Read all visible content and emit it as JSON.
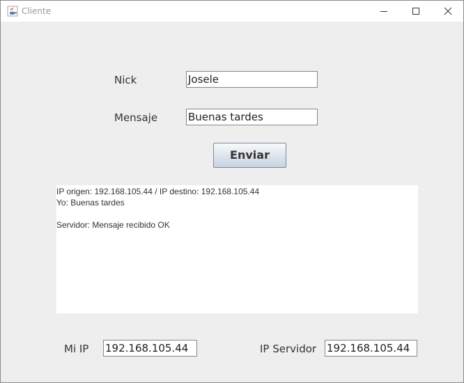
{
  "window": {
    "title": "Cliente",
    "app_icon": "java-coffee-cup-icon",
    "controls": [
      "minimize-icon",
      "maximize-icon",
      "close-icon"
    ]
  },
  "form": {
    "nick_label": "Nick",
    "nick_value": "Josele",
    "message_label": "Mensaje",
    "message_value": "Buenas tardes",
    "send_label": "Enviar"
  },
  "log": {
    "lines": [
      "IP origen: 192.168.105.44 / IP destino: 192.168.105.44",
      "Yo: Buenas tardes",
      "",
      "Servidor: Mensaje recibido OK"
    ]
  },
  "footer": {
    "my_ip_label": "Mi IP",
    "my_ip_value": "192.168.105.44",
    "server_ip_label": "IP Servidor",
    "server_ip_value": "192.168.105.44"
  }
}
